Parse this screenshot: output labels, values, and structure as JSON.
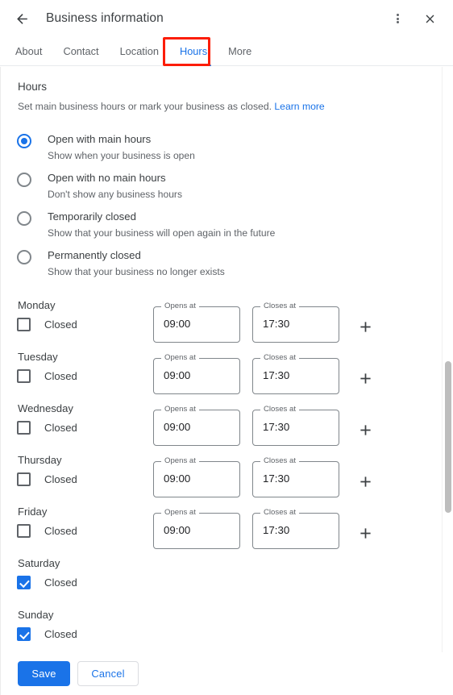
{
  "header": {
    "title": "Business information",
    "back_icon": "arrow-left-icon",
    "menu_icon": "more-vert-icon",
    "close_icon": "close-icon"
  },
  "tabs": [
    {
      "label": "About",
      "active": false
    },
    {
      "label": "Contact",
      "active": false
    },
    {
      "label": "Location",
      "active": false
    },
    {
      "label": "Hours",
      "active": true
    },
    {
      "label": "More",
      "active": false
    }
  ],
  "annotation": {
    "target": "Hours",
    "color": "#fc1d06"
  },
  "section": {
    "title": "Hours",
    "description": "Set main business hours or mark your business as closed.",
    "link_label": "Learn more"
  },
  "hours_mode_options": [
    {
      "label": "Open with main hours",
      "description": "Show when your business is open",
      "selected": true
    },
    {
      "label": "Open with no main hours",
      "description": "Don't show any business hours",
      "selected": false
    },
    {
      "label": "Temporarily closed",
      "description": "Show that your business will open again in the future",
      "selected": false
    },
    {
      "label": "Permanently closed",
      "description": "Show that your business no longer exists",
      "selected": false
    }
  ],
  "field_labels": {
    "opens_at": "Opens at",
    "closes_at": "Closes at",
    "closed": "Closed",
    "add_icon": "plus-icon"
  },
  "days": [
    {
      "name": "Monday",
      "closed": false,
      "opens_at": "09:00",
      "closes_at": "17:30",
      "has_fields": true
    },
    {
      "name": "Tuesday",
      "closed": false,
      "opens_at": "09:00",
      "closes_at": "17:30",
      "has_fields": true
    },
    {
      "name": "Wednesday",
      "closed": false,
      "opens_at": "09:00",
      "closes_at": "17:30",
      "has_fields": true
    },
    {
      "name": "Thursday",
      "closed": false,
      "opens_at": "09:00",
      "closes_at": "17:30",
      "has_fields": true
    },
    {
      "name": "Friday",
      "closed": false,
      "opens_at": "09:00",
      "closes_at": "17:30",
      "has_fields": true
    },
    {
      "name": "Saturday",
      "closed": true,
      "opens_at": "",
      "closes_at": "",
      "has_fields": false
    },
    {
      "name": "Sunday",
      "closed": true,
      "opens_at": "",
      "closes_at": "",
      "has_fields": false
    }
  ],
  "footer": {
    "save_label": "Save",
    "cancel_label": "Cancel"
  },
  "colors": {
    "accent": "#1a73e8",
    "text_primary": "#3c4043",
    "text_secondary": "#5f6368",
    "annotation": "#fc1d06"
  }
}
